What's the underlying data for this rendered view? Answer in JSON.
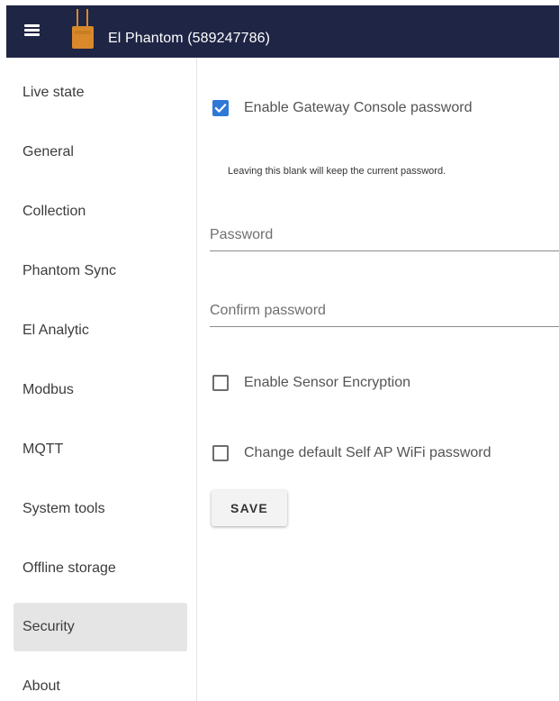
{
  "header": {
    "title": "El Phantom (589247786)",
    "background_color": "#1f2545",
    "menu_icon": "hamburger-menu-icon",
    "logo_icon": "phantom-device-icon",
    "logo_color": "#d9892a"
  },
  "sidebar": {
    "items": [
      {
        "label": "Live state",
        "active": false
      },
      {
        "label": "General",
        "active": false
      },
      {
        "label": "Collection",
        "active": false
      },
      {
        "label": "Phantom Sync",
        "active": false
      },
      {
        "label": "El Analytic",
        "active": false
      },
      {
        "label": "Modbus",
        "active": false
      },
      {
        "label": "MQTT",
        "active": false
      },
      {
        "label": "System tools",
        "active": false
      },
      {
        "label": "Offline storage",
        "active": false
      },
      {
        "label": "Security",
        "active": true
      },
      {
        "label": "About",
        "active": false
      }
    ]
  },
  "security": {
    "console_password_checkbox": {
      "label": "Enable Gateway Console password",
      "checked": true
    },
    "hint": "Leaving this blank will keep the current password.",
    "password_field": {
      "placeholder": "Password",
      "value": ""
    },
    "confirm_password_field": {
      "placeholder": "Confirm password",
      "value": ""
    },
    "sensor_encryption_checkbox": {
      "label": "Enable Sensor Encryption",
      "checked": false
    },
    "self_ap_password_checkbox": {
      "label": "Change default Self AP WiFi password",
      "checked": false
    },
    "save_label": "SAVE"
  },
  "colors": {
    "accent": "#2f78d6",
    "active_nav_background": "#e5e5e5"
  }
}
